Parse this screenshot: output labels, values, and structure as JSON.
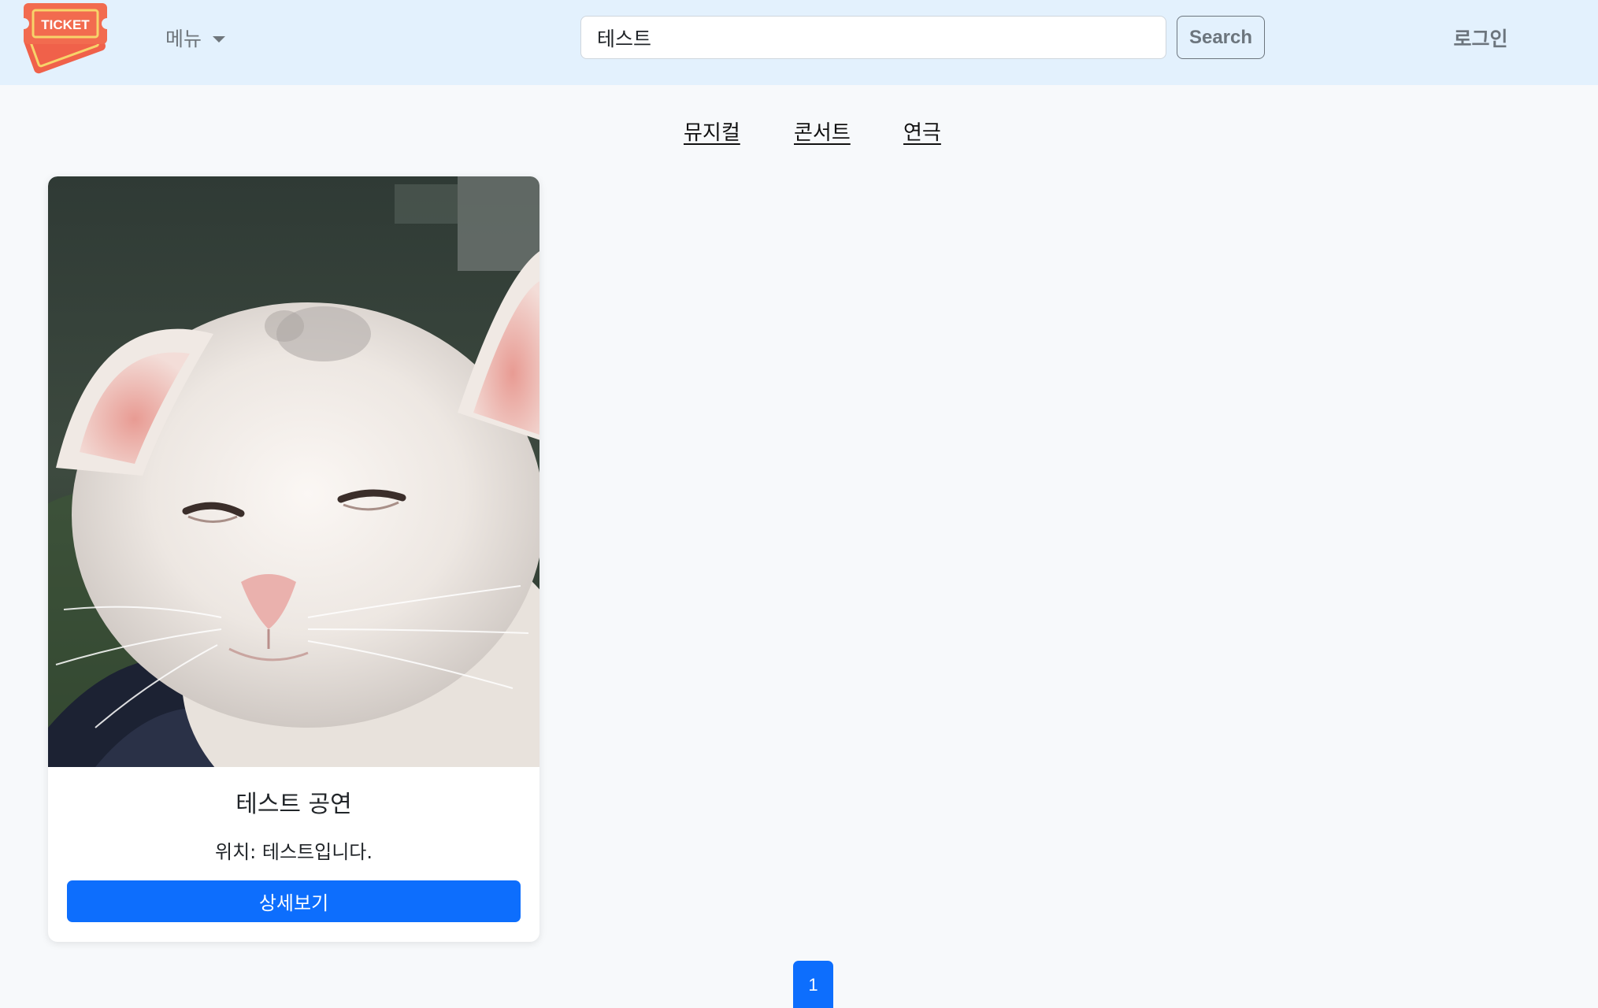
{
  "header": {
    "logo_text": "TICKET",
    "menu_label": "메뉴",
    "search": {
      "value": "테스트",
      "placeholder": "",
      "button_label": "Search"
    },
    "login_label": "로그인"
  },
  "categories": [
    {
      "label": "뮤지컬"
    },
    {
      "label": "콘서트"
    },
    {
      "label": "연극"
    }
  ],
  "results": [
    {
      "title": "테스트 공연",
      "location": "위치: 테스트입니다.",
      "button_label": "상세보기",
      "image": "white-kitten-photo"
    }
  ],
  "pagination": {
    "pages": [
      "1"
    ],
    "current": "1"
  },
  "colors": {
    "navbar_bg": "#e3f1fd",
    "page_bg": "#f7f9fb",
    "primary": "#0d6efd",
    "secondary": "#6c757d",
    "logo_orange": "#f26b4f"
  }
}
